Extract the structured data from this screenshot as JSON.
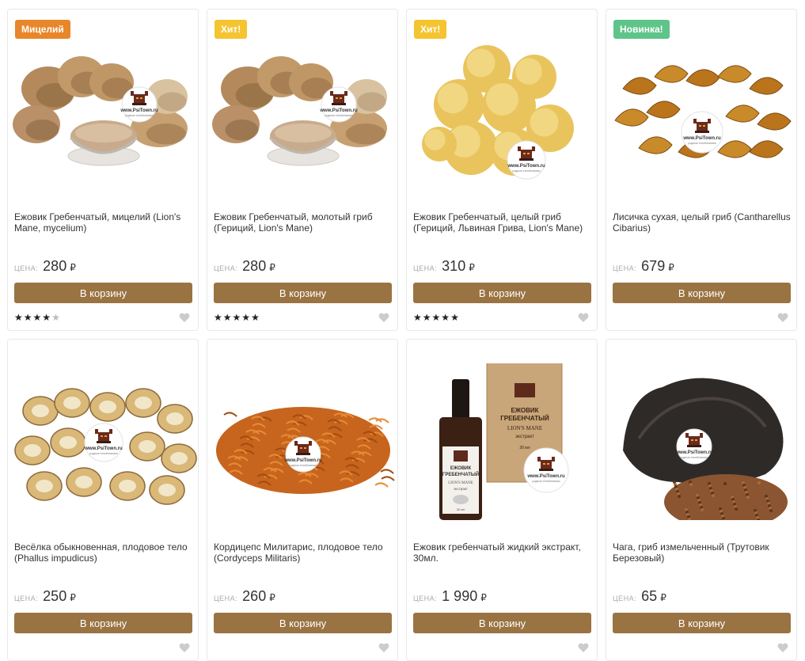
{
  "price_label": "ЦЕНА:",
  "currency": "₽",
  "cart_label": "В корзину",
  "products": [
    {
      "badge": "Мицелий",
      "badge_color": "#e8862a",
      "name": "Ежовик Гребенчатый, мицелий (Lion's Mane, mycelium)",
      "price": "280",
      "rating": 4.5,
      "image": "lions-mane-powder"
    },
    {
      "badge": "Хит!",
      "badge_color": "#f5c431",
      "name": "Ежовик Гребенчатый, молотый гриб (Гериций, Lion's Mane)",
      "price": "280",
      "rating": 5,
      "image": "lions-mane-powder"
    },
    {
      "badge": "Хит!",
      "badge_color": "#f5c431",
      "name": "Ежовик Гребенчатый, целый гриб (Гериций, Львиная Грива, Lion's Mane)",
      "price": "310",
      "rating": 5,
      "image": "lions-mane-whole"
    },
    {
      "badge": "Новинка!",
      "badge_color": "#5fc489",
      "name": "Лисичка сухая, целый гриб (Cantharellus Cibarius)",
      "price": "679",
      "rating": 0,
      "image": "chanterelle"
    },
    {
      "badge": "",
      "badge_color": "",
      "name": "Весёлка обыкновенная, плодовое тело (Phallus impudicus)",
      "price": "250",
      "rating": 0,
      "image": "phallus-slices"
    },
    {
      "badge": "",
      "badge_color": "",
      "name": "Кордицепс Милитарис, плодовое тело (Cordyceps Militaris)",
      "price": "260",
      "rating": 0,
      "image": "cordyceps"
    },
    {
      "badge": "",
      "badge_color": "",
      "name": "Ежовик гребенчатый жидкий экстракт, 30мл.",
      "price": "1 990",
      "rating": 0,
      "image": "extract-bottle",
      "box_text": [
        "ЕЖОВИК",
        "ГРЕБЕНЧАТЫЙ",
        "LION'S MANE",
        "экстракт",
        "30 мл"
      ],
      "bottle_text": [
        "ЕЖОВИК",
        "ГРЕБЕНЧАТЫЙ",
        "LION'S MANE",
        "экстракт",
        "30 мл"
      ]
    },
    {
      "badge": "",
      "badge_color": "",
      "name": "Чага, гриб измельченный (Трутовик Березовый)",
      "price": "65",
      "rating": 0,
      "image": "chaga"
    }
  ],
  "logo_text": "www.PsiTown.ru",
  "logo_subtext": "родные этноботаники",
  "colors": {
    "button": "#9a7342",
    "star": "#222222",
    "heart": "#cccccc"
  }
}
